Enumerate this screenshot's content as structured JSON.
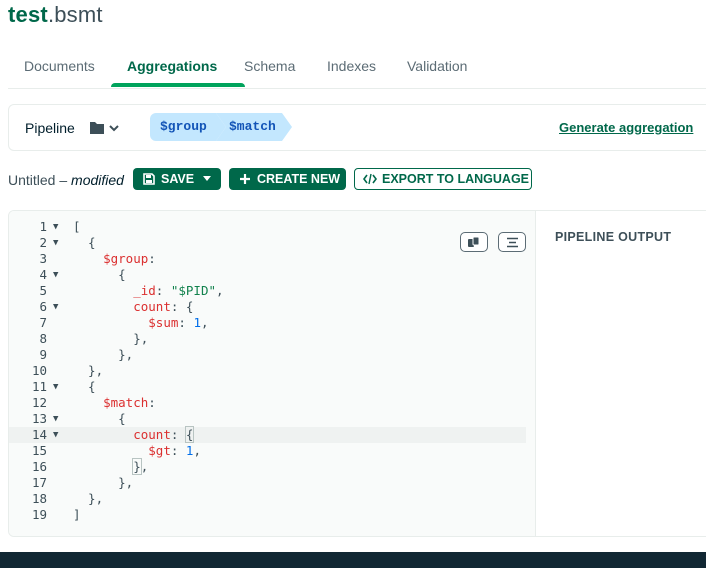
{
  "namespace": {
    "database": "test",
    "collection": ".bsmt"
  },
  "tabs": [
    "Documents",
    "Aggregations",
    "Schema",
    "Indexes",
    "Validation"
  ],
  "active_tab": "Aggregations",
  "pipeline": {
    "label": "Pipeline",
    "folder_icon": "folder-icon",
    "stages": [
      "$group",
      "$match"
    ],
    "generate_link": "Generate aggregation"
  },
  "toolbar": {
    "title": "Untitled",
    "separator": " – ",
    "status": "modified",
    "save_label": "SAVE",
    "create_label": "CREATE NEW",
    "export_label": "EXPORT TO LANGUAGE"
  },
  "editor": {
    "line_numbers": [
      "1",
      "2",
      "3",
      "4",
      "5",
      "6",
      "7",
      "8",
      "9",
      "10",
      "11",
      "12",
      "13",
      "14",
      "15",
      "16",
      "17",
      "18",
      "19"
    ],
    "active_line": 14,
    "copy_icon": "copy-icon",
    "format_icon": "format-icon"
  },
  "output": {
    "title": "PIPELINE OUTPUT"
  },
  "colors": {
    "brand_green": "#00684a",
    "accent_green": "#00a35c",
    "stage_bg": "#c3e7fe",
    "stage_text": "#1254b7",
    "json_key": "#db3030",
    "json_string": "#12824d",
    "json_number": "#016ee9",
    "footer_bg": "#112733"
  }
}
